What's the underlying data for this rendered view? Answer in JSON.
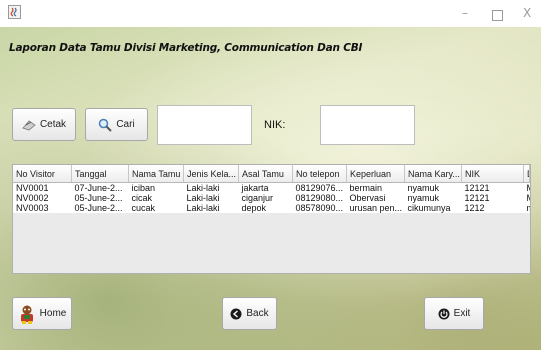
{
  "window": {
    "min_glyph": "–",
    "close_glyph": "X"
  },
  "heading": "Laporan Data Tamu Divisi Marketing, Communication Dan CBI",
  "toolbar": {
    "cetak_label": "Cetak",
    "cari_label": "Cari",
    "search_value": "",
    "nik_label": "NIK:",
    "nik_value": ""
  },
  "table": {
    "headers": [
      "No Visitor",
      "Tanggal",
      "Nama Tamu",
      "Jenis Kela...",
      "Asal Tamu",
      "No telepon",
      "Keperluan",
      "Nama Kary...",
      "NIK",
      "Divisi"
    ],
    "rows": [
      [
        "NV0001",
        "07-June-2...",
        "iciban",
        "Laki-laki",
        "jakarta",
        "08129076...",
        "bermain",
        "nyamuk",
        "12121",
        "Marketing"
      ],
      [
        "NV0002",
        "05-June-2...",
        "cicak",
        "Laki-laki",
        "ciganjur",
        "08129080...",
        "Obervasi",
        "nyamuk",
        "12121",
        "Marketing"
      ],
      [
        "NV0003",
        "05-June-2...",
        "cucak",
        "Laki-laki",
        "depok",
        "08578090...",
        "urusan pen...",
        "cikumunya",
        "1212",
        "marketing"
      ]
    ]
  },
  "footer": {
    "home_label": "Home",
    "back_label": "Back",
    "exit_label": "Exit"
  },
  "icons": {
    "app": "java-cup-icon",
    "cetak": "printer-icon",
    "cari": "magnifier-icon",
    "home": "mascot-icon",
    "back": "back-circle-icon",
    "exit": "power-icon"
  }
}
